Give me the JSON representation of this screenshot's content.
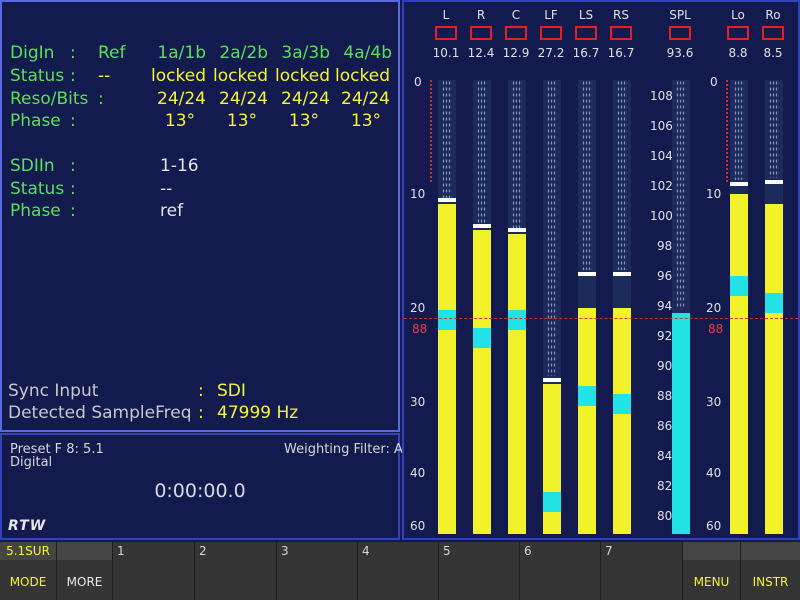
{
  "info": {
    "digin": {
      "label": "DigIn",
      "colon": ":",
      "ref": "Ref",
      "ch": [
        "1a/1b",
        "2a/2b",
        "3a/3b",
        "4a/4b"
      ]
    },
    "status": {
      "label": "Status",
      "colon": ":",
      "ref": "--",
      "vals": [
        "locked",
        "locked",
        "locked",
        "locked"
      ]
    },
    "reso": {
      "label": "Reso/Bits",
      "colon": ":",
      "vals": [
        "24/24",
        "24/24",
        "24/24",
        "24/24"
      ]
    },
    "phase": {
      "label": "Phase",
      "colon": ":",
      "vals": [
        "13°",
        "13°",
        "13°",
        "13°"
      ]
    },
    "sdi_in": {
      "label": "SDIIn",
      "colon": ":",
      "value": "1-16"
    },
    "sdi_status": {
      "label": "Status",
      "colon": ":",
      "value": "--"
    },
    "sdi_phase": {
      "label": "Phase",
      "colon": ":",
      "value": "ref"
    },
    "sync": {
      "label": "Sync Input",
      "colon": ":",
      "value": "SDI"
    },
    "freq": {
      "label": "Detected SampleFreq",
      "colon": ":",
      "value": "47999 Hz"
    }
  },
  "preset": {
    "name": "Preset F 8: 5.1",
    "type": "Digital",
    "weighting": "Weighting Filter: A",
    "time": "0:00:00.0",
    "logo": "RTW"
  },
  "meters": {
    "left_scale": [
      "0",
      "10",
      "20",
      "30",
      "40",
      "60"
    ],
    "right_scale": [
      "0",
      "10",
      "20",
      "30",
      "40",
      "60"
    ],
    "marker": "88",
    "marker_right": "88",
    "spl_scale": [
      "108",
      "106",
      "104",
      "102",
      "100",
      "98",
      "96",
      "94",
      "92",
      "90",
      "88",
      "86",
      "84",
      "82",
      "80"
    ],
    "channels": [
      {
        "name": "L",
        "value": "10.1"
      },
      {
        "name": "R",
        "value": "12.4"
      },
      {
        "name": "C",
        "value": "12.9"
      },
      {
        "name": "LF",
        "value": "27.2"
      },
      {
        "name": "LS",
        "value": "16.7"
      },
      {
        "name": "RS",
        "value": "16.7"
      },
      {
        "name": "SPL",
        "value": "93.6"
      },
      {
        "name": "Lo",
        "value": "8.8"
      },
      {
        "name": "Ro",
        "value": "8.5"
      }
    ]
  },
  "fkeys": [
    {
      "top": "5.1SUR",
      "bottom": "MODE"
    },
    {
      "top": "",
      "bottom": "MORE"
    },
    {
      "top": "1",
      "bottom": ""
    },
    {
      "top": "2",
      "bottom": ""
    },
    {
      "top": "3",
      "bottom": ""
    },
    {
      "top": "4",
      "bottom": ""
    },
    {
      "top": "5",
      "bottom": ""
    },
    {
      "top": "6",
      "bottom": ""
    },
    {
      "top": "7",
      "bottom": ""
    },
    {
      "top": "",
      "bottom": "MENU"
    },
    {
      "top": "",
      "bottom": "INSTR"
    }
  ],
  "colors": {
    "accent_green": "#5ae05a",
    "accent_yellow": "#f4f43c",
    "meter_yellow": "#f2f22a",
    "meter_cyan": "#22e2e6",
    "clip_red": "#e12020"
  }
}
